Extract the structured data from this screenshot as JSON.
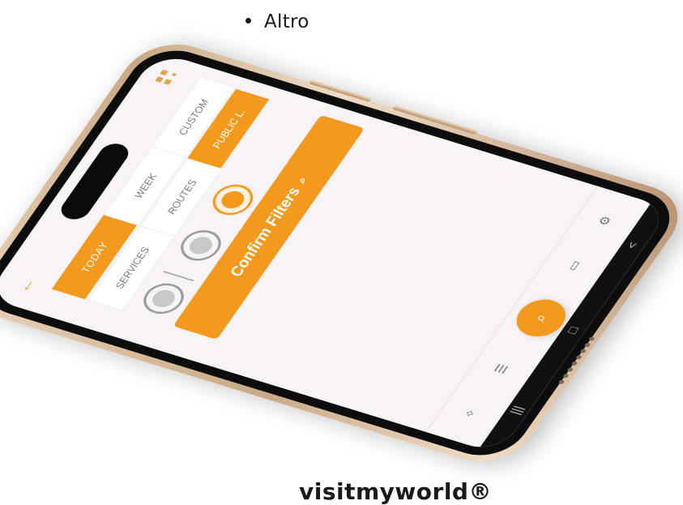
{
  "page": {
    "bullet_text": "Altro",
    "brand_text": "visitmyworld®"
  },
  "app": {
    "accent_color": "#f39a1e",
    "back_icon": "arrow-left-icon",
    "qr_icon": "qr-code-icon",
    "time_filters": [
      "TODAY",
      "WEEK",
      "CUSTOM"
    ],
    "time_filter_selected": "TODAY",
    "type_filters": [
      "SERVICES",
      "ROUTES",
      "PUBLIC L."
    ],
    "type_filter_selected": "PUBLIC L.",
    "categories": [
      {
        "icon": "triangle-badge-icon",
        "selected": false
      },
      {
        "icon": "photo-frame-icon",
        "selected": false
      },
      {
        "icon": "group-people-icon",
        "selected": true
      }
    ],
    "confirm_label": "Confirm Filters",
    "bottom_nav": [
      {
        "icon": "sparkles-icon"
      },
      {
        "icon": "list-search-icon"
      },
      {
        "icon": "search-icon",
        "primary": true
      },
      {
        "icon": "bookmarks-icon"
      },
      {
        "icon": "gear-icon"
      }
    ],
    "system_nav": [
      "|||",
      "□",
      "<"
    ]
  }
}
